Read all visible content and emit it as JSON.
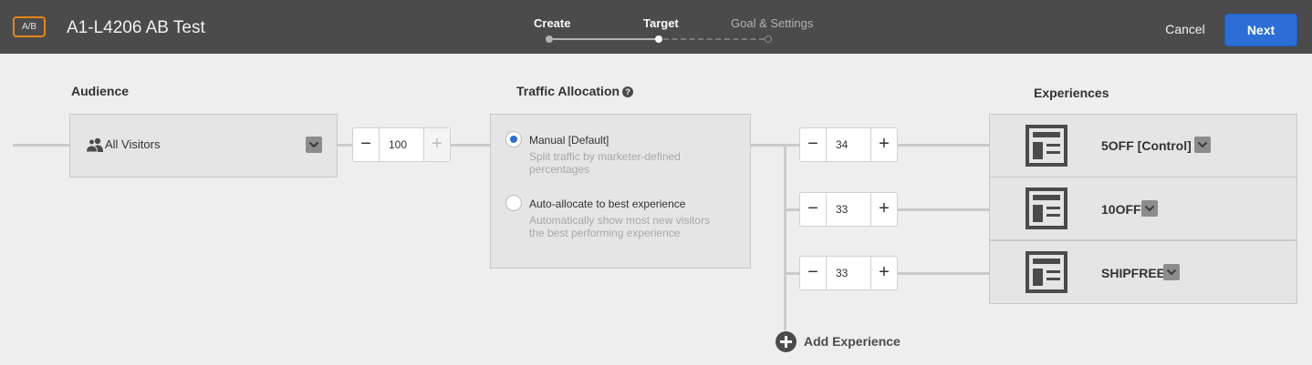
{
  "header": {
    "badge": "A/B",
    "title": "A1-L4206 AB Test",
    "steps": [
      {
        "label": "Create",
        "state": "done"
      },
      {
        "label": "Target",
        "state": "active"
      },
      {
        "label": "Goal & Settings",
        "state": "pending"
      }
    ],
    "cancel_label": "Cancel",
    "next_label": "Next"
  },
  "audience": {
    "heading": "Audience",
    "selected": "All Visitors",
    "icon": "users-icon",
    "allocation": "100"
  },
  "traffic": {
    "heading": "Traffic Allocation",
    "help_icon": "?",
    "options": [
      {
        "label": "Manual [Default]",
        "description": "Split traffic by marketer-defined percentages",
        "selected": true
      },
      {
        "label": "Auto-allocate to best experience",
        "description": "Automatically show most new visitors the best performing experience",
        "selected": false
      }
    ]
  },
  "experiences": {
    "heading": "Experiences",
    "items": [
      {
        "name": "5OFF [Control]",
        "allocation": "34",
        "icon": "layout-template-icon"
      },
      {
        "name": "10OFF",
        "allocation": "33",
        "icon": "layout-template-icon"
      },
      {
        "name": "SHIPFREE",
        "allocation": "33",
        "icon": "layout-template-icon"
      }
    ],
    "add_label": "Add Experience"
  },
  "colors": {
    "accent": "#2d6ed6",
    "badge_border": "#e68619",
    "header_bg": "#4b4b4b",
    "canvas_bg": "#eeeeee"
  }
}
